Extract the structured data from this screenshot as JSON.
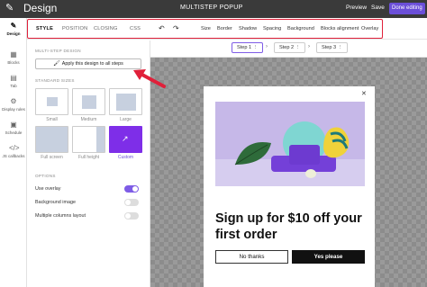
{
  "topbar": {
    "title": "Design",
    "center_title": "MULTISTEP POPUP",
    "preview": "Preview",
    "save": "Save",
    "done": "Done editing"
  },
  "rail": [
    {
      "label": "Design",
      "icon": "pencil-icon"
    },
    {
      "label": "Blocks",
      "icon": "blocks-icon"
    },
    {
      "label": "Tab",
      "icon": "tab-icon"
    },
    {
      "label": "Display rules",
      "icon": "display-rules-icon"
    },
    {
      "label": "Schedule",
      "icon": "calendar-icon"
    },
    {
      "label": "JS callbacks",
      "icon": "code-icon"
    }
  ],
  "toolbar": {
    "tabs": [
      "STYLE",
      "POSITION",
      "CLOSING",
      "CSS"
    ],
    "items": [
      "Size",
      "Border",
      "Shadow",
      "Spacing",
      "Background",
      "Blocks alignment",
      "Overlay"
    ]
  },
  "panel": {
    "multistep_label": "MULTI-STEP DESIGN",
    "apply_button": "Apply this design to all steps",
    "standard_sizes_label": "STANDARD SIZES",
    "sizes": [
      "Small",
      "Medium",
      "Large",
      "Full screen",
      "Full height",
      "Custom"
    ],
    "options_label": "OPTIONS",
    "options": [
      {
        "label": "Use overlay",
        "on": true
      },
      {
        "label": "Background image",
        "on": false
      },
      {
        "label": "Multiple columns layout",
        "on": false
      }
    ]
  },
  "steps": [
    "Step 1",
    "Step 2",
    "Step 3"
  ],
  "popup": {
    "headline": "Sign up for $10 off your first order",
    "no_button": "No thanks",
    "yes_button": "Yes please"
  },
  "colors": {
    "accent": "#7e5ce6",
    "highlight": "#e0203a",
    "topbar": "#3a3a3a"
  }
}
